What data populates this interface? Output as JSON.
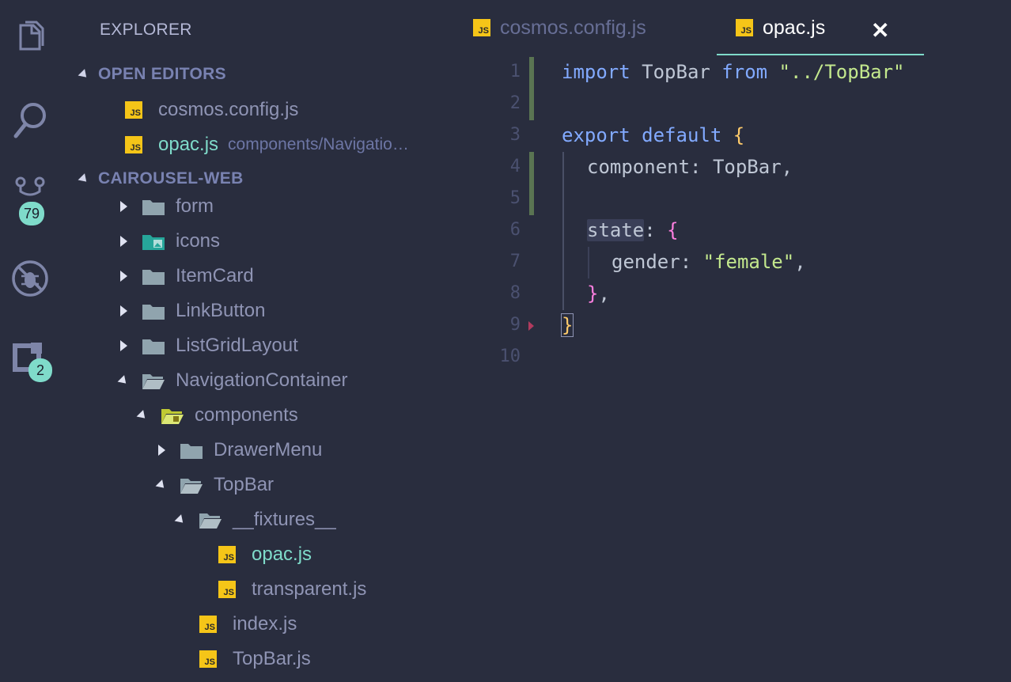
{
  "activity_bar": {
    "icons": [
      "files-icon",
      "search-icon",
      "source-control-icon",
      "debug-icon",
      "extensions-icon"
    ],
    "scm_badge": "79",
    "extensions_badge": "2"
  },
  "sidebar": {
    "title": "EXPLORER",
    "open_editors_header": "OPEN EDITORS",
    "open_editors": [
      {
        "name": "cosmos.config.js",
        "path": ""
      },
      {
        "name": "opac.js",
        "path": "components/Navigatio…"
      }
    ],
    "project_header": "CAIROUSEL-WEB",
    "tree": [
      {
        "label": "form",
        "type": "folder"
      },
      {
        "label": "icons",
        "type": "folder"
      },
      {
        "label": "ItemCard",
        "type": "folder"
      },
      {
        "label": "LinkButton",
        "type": "folder"
      },
      {
        "label": "ListGridLayout",
        "type": "folder"
      },
      {
        "label": "NavigationContainer",
        "type": "folder"
      },
      {
        "label": "components",
        "type": "folder"
      },
      {
        "label": "DrawerMenu",
        "type": "folder"
      },
      {
        "label": "TopBar",
        "type": "folder"
      },
      {
        "label": "__fixtures__",
        "type": "folder"
      },
      {
        "label": "opac.js",
        "type": "file"
      },
      {
        "label": "transparent.js",
        "type": "file"
      },
      {
        "label": "index.js",
        "type": "file"
      },
      {
        "label": "TopBar.js",
        "type": "file"
      }
    ]
  },
  "editor": {
    "tabs": [
      {
        "label": "cosmos.config.js",
        "active": false
      },
      {
        "label": "opac.js",
        "active": true
      }
    ],
    "close_label": "✕",
    "line_numbers": [
      "1",
      "2",
      "3",
      "4",
      "5",
      "6",
      "7",
      "8",
      "9",
      "10"
    ],
    "code": {
      "l1_kw": "import",
      "l1_id": " TopBar ",
      "l1_from": "from",
      "l1_str": " \"../TopBar\"",
      "l3_export": "export",
      "l3_default": " default",
      "l3_brace": "{",
      "l4_prop": "component",
      "l4_rest": ": TopBar,",
      "l6_prop": "state",
      "l6_colon": ": ",
      "l6_brace": "{",
      "l7_prop": "gender",
      "l7_colon": ": ",
      "l7_str": "\"female\"",
      "l7_comma": ",",
      "l8_brace": "}",
      "l8_comma": ",",
      "l9_brace": "}"
    }
  },
  "colors": {
    "background": "#292d3e",
    "accent": "#7fdbca",
    "js_icon": "#f5c518"
  }
}
